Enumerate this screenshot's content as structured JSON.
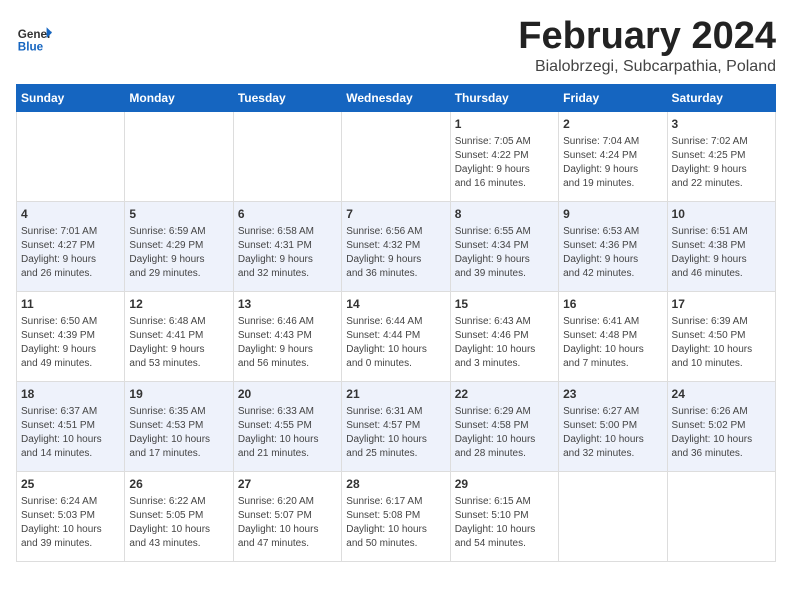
{
  "header": {
    "logo_general": "General",
    "logo_blue": "Blue",
    "title": "February 2024",
    "subtitle": "Bialobrzegi, Subcarpathia, Poland"
  },
  "calendar": {
    "days_of_week": [
      "Sunday",
      "Monday",
      "Tuesday",
      "Wednesday",
      "Thursday",
      "Friday",
      "Saturday"
    ],
    "weeks": [
      [
        {
          "day": "",
          "content": ""
        },
        {
          "day": "",
          "content": ""
        },
        {
          "day": "",
          "content": ""
        },
        {
          "day": "",
          "content": ""
        },
        {
          "day": "1",
          "content": "Sunrise: 7:05 AM\nSunset: 4:22 PM\nDaylight: 9 hours\nand 16 minutes."
        },
        {
          "day": "2",
          "content": "Sunrise: 7:04 AM\nSunset: 4:24 PM\nDaylight: 9 hours\nand 19 minutes."
        },
        {
          "day": "3",
          "content": "Sunrise: 7:02 AM\nSunset: 4:25 PM\nDaylight: 9 hours\nand 22 minutes."
        }
      ],
      [
        {
          "day": "4",
          "content": "Sunrise: 7:01 AM\nSunset: 4:27 PM\nDaylight: 9 hours\nand 26 minutes."
        },
        {
          "day": "5",
          "content": "Sunrise: 6:59 AM\nSunset: 4:29 PM\nDaylight: 9 hours\nand 29 minutes."
        },
        {
          "day": "6",
          "content": "Sunrise: 6:58 AM\nSunset: 4:31 PM\nDaylight: 9 hours\nand 32 minutes."
        },
        {
          "day": "7",
          "content": "Sunrise: 6:56 AM\nSunset: 4:32 PM\nDaylight: 9 hours\nand 36 minutes."
        },
        {
          "day": "8",
          "content": "Sunrise: 6:55 AM\nSunset: 4:34 PM\nDaylight: 9 hours\nand 39 minutes."
        },
        {
          "day": "9",
          "content": "Sunrise: 6:53 AM\nSunset: 4:36 PM\nDaylight: 9 hours\nand 42 minutes."
        },
        {
          "day": "10",
          "content": "Sunrise: 6:51 AM\nSunset: 4:38 PM\nDaylight: 9 hours\nand 46 minutes."
        }
      ],
      [
        {
          "day": "11",
          "content": "Sunrise: 6:50 AM\nSunset: 4:39 PM\nDaylight: 9 hours\nand 49 minutes."
        },
        {
          "day": "12",
          "content": "Sunrise: 6:48 AM\nSunset: 4:41 PM\nDaylight: 9 hours\nand 53 minutes."
        },
        {
          "day": "13",
          "content": "Sunrise: 6:46 AM\nSunset: 4:43 PM\nDaylight: 9 hours\nand 56 minutes."
        },
        {
          "day": "14",
          "content": "Sunrise: 6:44 AM\nSunset: 4:44 PM\nDaylight: 10 hours\nand 0 minutes."
        },
        {
          "day": "15",
          "content": "Sunrise: 6:43 AM\nSunset: 4:46 PM\nDaylight: 10 hours\nand 3 minutes."
        },
        {
          "day": "16",
          "content": "Sunrise: 6:41 AM\nSunset: 4:48 PM\nDaylight: 10 hours\nand 7 minutes."
        },
        {
          "day": "17",
          "content": "Sunrise: 6:39 AM\nSunset: 4:50 PM\nDaylight: 10 hours\nand 10 minutes."
        }
      ],
      [
        {
          "day": "18",
          "content": "Sunrise: 6:37 AM\nSunset: 4:51 PM\nDaylight: 10 hours\nand 14 minutes."
        },
        {
          "day": "19",
          "content": "Sunrise: 6:35 AM\nSunset: 4:53 PM\nDaylight: 10 hours\nand 17 minutes."
        },
        {
          "day": "20",
          "content": "Sunrise: 6:33 AM\nSunset: 4:55 PM\nDaylight: 10 hours\nand 21 minutes."
        },
        {
          "day": "21",
          "content": "Sunrise: 6:31 AM\nSunset: 4:57 PM\nDaylight: 10 hours\nand 25 minutes."
        },
        {
          "day": "22",
          "content": "Sunrise: 6:29 AM\nSunset: 4:58 PM\nDaylight: 10 hours\nand 28 minutes."
        },
        {
          "day": "23",
          "content": "Sunrise: 6:27 AM\nSunset: 5:00 PM\nDaylight: 10 hours\nand 32 minutes."
        },
        {
          "day": "24",
          "content": "Sunrise: 6:26 AM\nSunset: 5:02 PM\nDaylight: 10 hours\nand 36 minutes."
        }
      ],
      [
        {
          "day": "25",
          "content": "Sunrise: 6:24 AM\nSunset: 5:03 PM\nDaylight: 10 hours\nand 39 minutes."
        },
        {
          "day": "26",
          "content": "Sunrise: 6:22 AM\nSunset: 5:05 PM\nDaylight: 10 hours\nand 43 minutes."
        },
        {
          "day": "27",
          "content": "Sunrise: 6:20 AM\nSunset: 5:07 PM\nDaylight: 10 hours\nand 47 minutes."
        },
        {
          "day": "28",
          "content": "Sunrise: 6:17 AM\nSunset: 5:08 PM\nDaylight: 10 hours\nand 50 minutes."
        },
        {
          "day": "29",
          "content": "Sunrise: 6:15 AM\nSunset: 5:10 PM\nDaylight: 10 hours\nand 54 minutes."
        },
        {
          "day": "",
          "content": ""
        },
        {
          "day": "",
          "content": ""
        }
      ]
    ]
  }
}
